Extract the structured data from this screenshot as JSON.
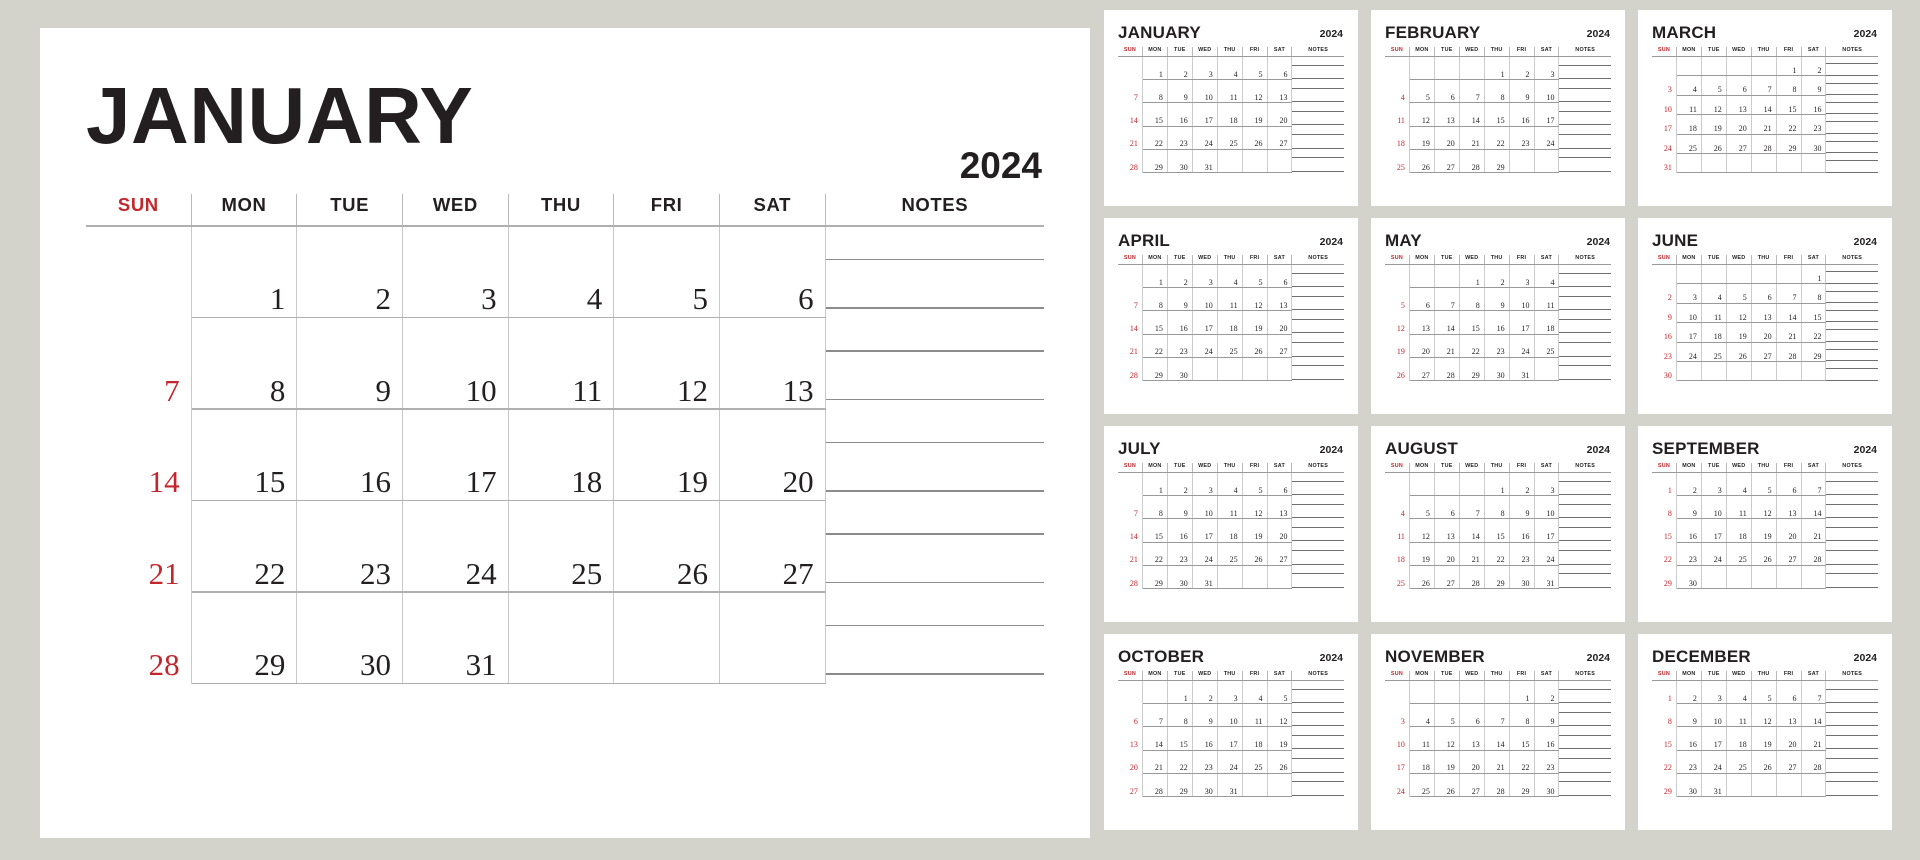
{
  "theme": {
    "page_background": "#d3d3cb",
    "panel_background": "#ffffff",
    "text_color": "#231f20",
    "sunday_color": "#c1272d",
    "rule_color": "#b0b0b0"
  },
  "main": {
    "month": "JANUARY",
    "year": "2024",
    "weekday_headers": [
      "SUN",
      "MON",
      "TUE",
      "WED",
      "THU",
      "FRI",
      "SAT"
    ],
    "notes_header": "NOTES",
    "weeks": [
      [
        "",
        "1",
        "2",
        "3",
        "4",
        "5",
        "6"
      ],
      [
        "7",
        "8",
        "9",
        "10",
        "11",
        "12",
        "13"
      ],
      [
        "14",
        "15",
        "16",
        "17",
        "18",
        "19",
        "20"
      ],
      [
        "21",
        "22",
        "23",
        "24",
        "25",
        "26",
        "27"
      ],
      [
        "28",
        "29",
        "30",
        "31",
        "",
        "",
        ""
      ]
    ]
  },
  "minis": [
    {
      "month": "JANUARY",
      "year": "2024",
      "weekday_headers": [
        "SUN",
        "MON",
        "TUE",
        "WED",
        "THU",
        "FRI",
        "SAT"
      ],
      "notes_header": "NOTES",
      "weeks": [
        [
          "",
          "1",
          "2",
          "3",
          "4",
          "5",
          "6"
        ],
        [
          "7",
          "8",
          "9",
          "10",
          "11",
          "12",
          "13"
        ],
        [
          "14",
          "15",
          "16",
          "17",
          "18",
          "19",
          "20"
        ],
        [
          "21",
          "22",
          "23",
          "24",
          "25",
          "26",
          "27"
        ],
        [
          "28",
          "29",
          "30",
          "31",
          "",
          "",
          ""
        ]
      ]
    },
    {
      "month": "FEBRUARY",
      "year": "2024",
      "weekday_headers": [
        "SUN",
        "MON",
        "TUE",
        "WED",
        "THU",
        "FRI",
        "SAT"
      ],
      "notes_header": "NOTES",
      "weeks": [
        [
          "",
          "",
          "",
          "",
          "1",
          "2",
          "3"
        ],
        [
          "4",
          "5",
          "6",
          "7",
          "8",
          "9",
          "10"
        ],
        [
          "11",
          "12",
          "13",
          "14",
          "15",
          "16",
          "17"
        ],
        [
          "18",
          "19",
          "20",
          "21",
          "22",
          "23",
          "24"
        ],
        [
          "25",
          "26",
          "27",
          "28",
          "29",
          "",
          ""
        ]
      ]
    },
    {
      "month": "MARCH",
      "year": "2024",
      "weekday_headers": [
        "SUN",
        "MON",
        "TUE",
        "WED",
        "THU",
        "FRI",
        "SAT"
      ],
      "notes_header": "NOTES",
      "weeks": [
        [
          "",
          "",
          "",
          "",
          "",
          "1",
          "2"
        ],
        [
          "3",
          "4",
          "5",
          "6",
          "7",
          "8",
          "9"
        ],
        [
          "10",
          "11",
          "12",
          "13",
          "14",
          "15",
          "16"
        ],
        [
          "17",
          "18",
          "19",
          "20",
          "21",
          "22",
          "23"
        ],
        [
          "24",
          "25",
          "26",
          "27",
          "28",
          "29",
          "30"
        ],
        [
          "31",
          "",
          "",
          "",
          "",
          "",
          ""
        ]
      ]
    },
    {
      "month": "APRIL",
      "year": "2024",
      "weekday_headers": [
        "SUN",
        "MON",
        "TUE",
        "WED",
        "THU",
        "FRI",
        "SAT"
      ],
      "notes_header": "NOTES",
      "weeks": [
        [
          "",
          "1",
          "2",
          "3",
          "4",
          "5",
          "6"
        ],
        [
          "7",
          "8",
          "9",
          "10",
          "11",
          "12",
          "13"
        ],
        [
          "14",
          "15",
          "16",
          "17",
          "18",
          "19",
          "20"
        ],
        [
          "21",
          "22",
          "23",
          "24",
          "25",
          "26",
          "27"
        ],
        [
          "28",
          "29",
          "30",
          "",
          "",
          "",
          ""
        ]
      ]
    },
    {
      "month": "MAY",
      "year": "2024",
      "weekday_headers": [
        "SUN",
        "MON",
        "TUE",
        "WED",
        "THU",
        "FRI",
        "SAT"
      ],
      "notes_header": "NOTES",
      "weeks": [
        [
          "",
          "",
          "",
          "1",
          "2",
          "3",
          "4"
        ],
        [
          "5",
          "6",
          "7",
          "8",
          "9",
          "10",
          "11"
        ],
        [
          "12",
          "13",
          "14",
          "15",
          "16",
          "17",
          "18"
        ],
        [
          "19",
          "20",
          "21",
          "22",
          "23",
          "24",
          "25"
        ],
        [
          "26",
          "27",
          "28",
          "29",
          "30",
          "31",
          ""
        ]
      ]
    },
    {
      "month": "JUNE",
      "year": "2024",
      "weekday_headers": [
        "SUN",
        "MON",
        "TUE",
        "WED",
        "THU",
        "FRI",
        "SAT"
      ],
      "notes_header": "NOTES",
      "weeks": [
        [
          "",
          "",
          "",
          "",
          "",
          "",
          "1"
        ],
        [
          "2",
          "3",
          "4",
          "5",
          "6",
          "7",
          "8"
        ],
        [
          "9",
          "10",
          "11",
          "12",
          "13",
          "14",
          "15"
        ],
        [
          "16",
          "17",
          "18",
          "19",
          "20",
          "21",
          "22"
        ],
        [
          "23",
          "24",
          "25",
          "26",
          "27",
          "28",
          "29"
        ],
        [
          "30",
          "",
          "",
          "",
          "",
          "",
          ""
        ]
      ]
    },
    {
      "month": "JULY",
      "year": "2024",
      "weekday_headers": [
        "SUN",
        "MON",
        "TUE",
        "WED",
        "THU",
        "FRI",
        "SAT"
      ],
      "notes_header": "NOTES",
      "weeks": [
        [
          "",
          "1",
          "2",
          "3",
          "4",
          "5",
          "6"
        ],
        [
          "7",
          "8",
          "9",
          "10",
          "11",
          "12",
          "13"
        ],
        [
          "14",
          "15",
          "16",
          "17",
          "18",
          "19",
          "20"
        ],
        [
          "21",
          "22",
          "23",
          "24",
          "25",
          "26",
          "27"
        ],
        [
          "28",
          "29",
          "30",
          "31",
          "",
          "",
          ""
        ]
      ]
    },
    {
      "month": "AUGUST",
      "year": "2024",
      "weekday_headers": [
        "SUN",
        "MON",
        "TUE",
        "WED",
        "THU",
        "FRI",
        "SAT"
      ],
      "notes_header": "NOTES",
      "weeks": [
        [
          "",
          "",
          "",
          "",
          "1",
          "2",
          "3"
        ],
        [
          "4",
          "5",
          "6",
          "7",
          "8",
          "9",
          "10"
        ],
        [
          "11",
          "12",
          "13",
          "14",
          "15",
          "16",
          "17"
        ],
        [
          "18",
          "19",
          "20",
          "21",
          "22",
          "23",
          "24"
        ],
        [
          "25",
          "26",
          "27",
          "28",
          "29",
          "30",
          "31"
        ]
      ]
    },
    {
      "month": "SEPTEMBER",
      "year": "2024",
      "weekday_headers": [
        "SUN",
        "MON",
        "TUE",
        "WED",
        "THU",
        "FRI",
        "SAT"
      ],
      "notes_header": "NOTES",
      "weeks": [
        [
          "1",
          "2",
          "3",
          "4",
          "5",
          "6",
          "7"
        ],
        [
          "8",
          "9",
          "10",
          "11",
          "12",
          "13",
          "14"
        ],
        [
          "15",
          "16",
          "17",
          "18",
          "19",
          "20",
          "21"
        ],
        [
          "22",
          "23",
          "24",
          "25",
          "26",
          "27",
          "28"
        ],
        [
          "29",
          "30",
          "",
          "",
          "",
          "",
          ""
        ]
      ]
    },
    {
      "month": "OCTOBER",
      "year": "2024",
      "weekday_headers": [
        "SUN",
        "MON",
        "TUE",
        "WED",
        "THU",
        "FRI",
        "SAT"
      ],
      "notes_header": "NOTES",
      "weeks": [
        [
          "",
          "",
          "1",
          "2",
          "3",
          "4",
          "5"
        ],
        [
          "6",
          "7",
          "8",
          "9",
          "10",
          "11",
          "12"
        ],
        [
          "13",
          "14",
          "15",
          "16",
          "17",
          "18",
          "19"
        ],
        [
          "20",
          "21",
          "22",
          "23",
          "24",
          "25",
          "26"
        ],
        [
          "27",
          "28",
          "29",
          "30",
          "31",
          "",
          ""
        ]
      ]
    },
    {
      "month": "NOVEMBER",
      "year": "2024",
      "weekday_headers": [
        "SUN",
        "MON",
        "TUE",
        "WED",
        "THU",
        "FRI",
        "SAT"
      ],
      "notes_header": "NOTES",
      "weeks": [
        [
          "",
          "",
          "",
          "",
          "",
          "1",
          "2"
        ],
        [
          "3",
          "4",
          "5",
          "6",
          "7",
          "8",
          "9"
        ],
        [
          "10",
          "11",
          "12",
          "13",
          "14",
          "15",
          "16"
        ],
        [
          "17",
          "18",
          "19",
          "20",
          "21",
          "22",
          "23"
        ],
        [
          "24",
          "25",
          "26",
          "27",
          "28",
          "29",
          "30"
        ]
      ]
    },
    {
      "month": "DECEMBER",
      "year": "2024",
      "weekday_headers": [
        "SUN",
        "MON",
        "TUE",
        "WED",
        "THU",
        "FRI",
        "SAT"
      ],
      "notes_header": "NOTES",
      "weeks": [
        [
          "1",
          "2",
          "3",
          "4",
          "5",
          "6",
          "7"
        ],
        [
          "8",
          "9",
          "10",
          "11",
          "12",
          "13",
          "14"
        ],
        [
          "15",
          "16",
          "17",
          "18",
          "19",
          "20",
          "21"
        ],
        [
          "22",
          "23",
          "24",
          "25",
          "26",
          "27",
          "28"
        ],
        [
          "29",
          "30",
          "31",
          "",
          "",
          "",
          ""
        ]
      ]
    }
  ]
}
